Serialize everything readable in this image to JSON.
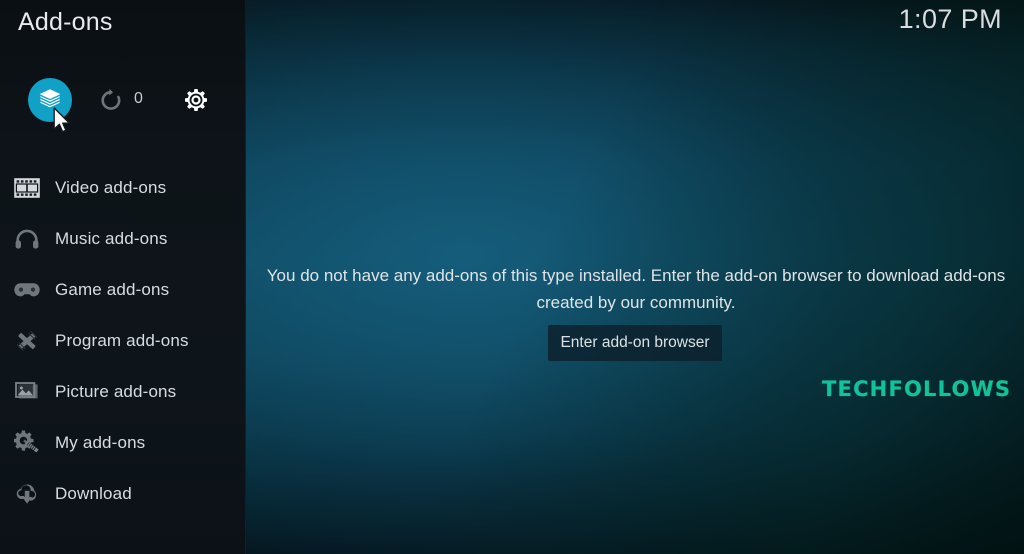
{
  "window": {
    "title": "Add-ons",
    "clock": "1:07 PM"
  },
  "toolbar": {
    "addons_button": "add-ons",
    "update_button": "available updates",
    "update_count": "0",
    "settings_button": "settings"
  },
  "sidebar": {
    "items": [
      {
        "label": "Video add-ons",
        "icon": "film-strip-icon"
      },
      {
        "label": "Music add-ons",
        "icon": "headphones-icon"
      },
      {
        "label": "Game add-ons",
        "icon": "gamepad-icon"
      },
      {
        "label": "Program add-ons",
        "icon": "tools-icon"
      },
      {
        "label": "Picture add-ons",
        "icon": "picture-icon"
      },
      {
        "label": "My add-ons",
        "icon": "gear-screwdriver-icon"
      },
      {
        "label": "Download",
        "icon": "cloud-download-icon"
      }
    ]
  },
  "main": {
    "empty_message": "You do not have any add-ons of this type installed. Enter the add-on browser to download add-ons created by our community.",
    "enter_browser_label": "Enter add-on browser"
  },
  "watermark": {
    "text": "TECHFOLLOWS"
  },
  "colors": {
    "accent": "#11a0c6",
    "sidebar_bg": "#0d1318",
    "content_bg": "#0f4a60",
    "watermark": "#12c39a",
    "text": "#d8dcdf"
  }
}
